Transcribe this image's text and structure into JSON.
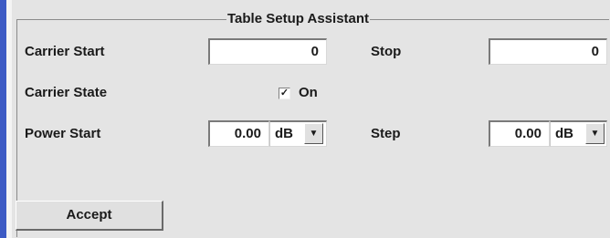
{
  "group_title": "Table Setup Assistant",
  "carrier_start": {
    "label": "Carrier Start",
    "value": "0"
  },
  "carrier_stop": {
    "label": "Stop",
    "value": "0"
  },
  "carrier_state": {
    "label": "Carrier State",
    "check_mark": "✓",
    "checkbox_label": "On",
    "checked": true
  },
  "power_start": {
    "label": "Power Start",
    "value": "0.00",
    "unit": "dB"
  },
  "power_step": {
    "label": "Step",
    "value": "0.00",
    "unit": "dB"
  },
  "accept_label": "Accept",
  "icons": {
    "dropdown": "chevron-down-icon"
  },
  "colors": {
    "accent_bar": "#3c5ac4",
    "panel_bg": "#e4e4e4",
    "field_bg": "#ffffff"
  }
}
